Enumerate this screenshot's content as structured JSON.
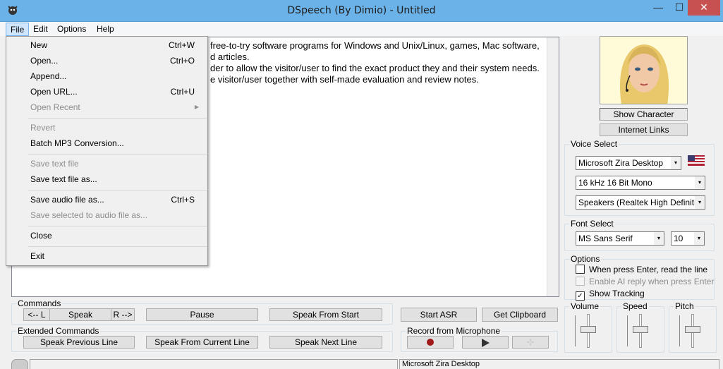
{
  "window": {
    "title": "DSpeech (By Dimio) - Untitled",
    "minimize": "—",
    "maximize": "☐",
    "close": "✕"
  },
  "menubar": {
    "file": "File",
    "edit": "Edit",
    "options": "Options",
    "help": "Help"
  },
  "file_menu": {
    "new": {
      "label": "New",
      "shortcut": "Ctrl+W"
    },
    "open": {
      "label": "Open...",
      "shortcut": "Ctrl+O"
    },
    "append": {
      "label": "Append..."
    },
    "open_url": {
      "label": "Open URL...",
      "shortcut": "Ctrl+U"
    },
    "open_recent": {
      "label": "Open Recent"
    },
    "revert": {
      "label": "Revert"
    },
    "batch_mp3": {
      "label": "Batch MP3 Conversion..."
    },
    "save_text": {
      "label": "Save text file"
    },
    "save_text_as": {
      "label": "Save text file as..."
    },
    "save_audio_as": {
      "label": "Save audio file as...",
      "shortcut": "Ctrl+S"
    },
    "save_selected_audio": {
      "label": "Save selected to audio file as..."
    },
    "close": {
      "label": "Close"
    },
    "exit": {
      "label": "Exit"
    }
  },
  "editor": {
    "text": "free-to-try software programs for Windows and Unix/Linux, games, Mac software,\nd articles.\nder to allow the visitor/user to find the exact product they and their system needs.\ne visitor/user together with self-made evaluation and review notes."
  },
  "character": {
    "show_character": "Show Character",
    "internet_links": "Internet Links"
  },
  "voice_select": {
    "title": "Voice Select",
    "voice": "Microsoft Zira Desktop",
    "format": "16 kHz 16 Bit Mono",
    "output": "Speakers (Realtek High Definition A",
    "flag": "us-flag-icon"
  },
  "font_select": {
    "title": "Font Select",
    "font": "MS Sans Serif",
    "size": "10"
  },
  "options": {
    "title": "Options",
    "enter_read_line": {
      "label": "When press Enter, read the line",
      "checked": false
    },
    "ai_reply": {
      "label": "Enable AI reply when press Enter",
      "checked": false
    },
    "show_tracking": {
      "label": "Show Tracking",
      "checked": true
    }
  },
  "commands": {
    "title": "Commands",
    "prev": "<-- L",
    "speak": "Speak",
    "next": "R -->",
    "pause": "Pause",
    "speak_from_start": "Speak From Start",
    "start_asr": "Start ASR",
    "get_clipboard": "Get Clipboard"
  },
  "extended_commands": {
    "title": "Extended Commands",
    "speak_previous_line": "Speak Previous Line",
    "speak_from_current_line": "Speak From Current Line",
    "speak_next_line": "Speak Next Line"
  },
  "record": {
    "title": "Record from Microphone",
    "record_icon": "record-icon",
    "play_icon": "play-icon",
    "stop_icon": "stop-icon"
  },
  "sliders": {
    "volume": "Volume",
    "speed": "Speed",
    "pitch": "Pitch"
  },
  "status": {
    "voice": "Microsoft Zira Desktop"
  }
}
